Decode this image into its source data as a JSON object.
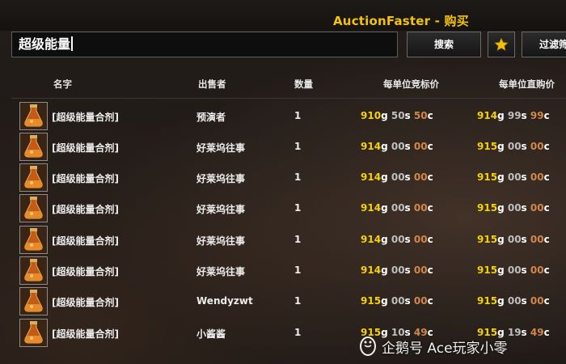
{
  "window": {
    "title": "AuctionFaster - 购买"
  },
  "search": {
    "value": "超级能量"
  },
  "toolbar": {
    "search_label": "搜索",
    "filter_label": "过滤筛"
  },
  "columns": [
    "名字",
    "出售者",
    "数量",
    "每单位竞标价",
    "每单位直购价"
  ],
  "rows": [
    {
      "name": "[超级能量合剂]",
      "seller": "预演者",
      "qty": "1",
      "bid": {
        "g": "910",
        "s": "50",
        "c": "50"
      },
      "buy": {
        "g": "914",
        "s": "99",
        "c": "99"
      }
    },
    {
      "name": "[超级能量合剂]",
      "seller": "好莱坞往事",
      "qty": "1",
      "bid": {
        "g": "914",
        "s": "00",
        "c": "00"
      },
      "buy": {
        "g": "915",
        "s": "00",
        "c": "00"
      }
    },
    {
      "name": "[超级能量合剂]",
      "seller": "好莱坞往事",
      "qty": "1",
      "bid": {
        "g": "914",
        "s": "00",
        "c": "00"
      },
      "buy": {
        "g": "915",
        "s": "00",
        "c": "00"
      }
    },
    {
      "name": "[超级能量合剂]",
      "seller": "好莱坞往事",
      "qty": "1",
      "bid": {
        "g": "914",
        "s": "00",
        "c": "00"
      },
      "buy": {
        "g": "915",
        "s": "00",
        "c": "00"
      }
    },
    {
      "name": "[超级能量合剂]",
      "seller": "好莱坞往事",
      "qty": "1",
      "bid": {
        "g": "914",
        "s": "00",
        "c": "00"
      },
      "buy": {
        "g": "915",
        "s": "00",
        "c": "00"
      }
    },
    {
      "name": "[超级能量合剂]",
      "seller": "好莱坞往事",
      "qty": "1",
      "bid": {
        "g": "914",
        "s": "00",
        "c": "00"
      },
      "buy": {
        "g": "915",
        "s": "00",
        "c": "00"
      }
    },
    {
      "name": "[超级能量合剂]",
      "seller": "Wendyzwt",
      "qty": "1",
      "bid": {
        "g": "915",
        "s": "00",
        "c": "00"
      },
      "buy": {
        "g": "915",
        "s": "00",
        "c": "00"
      }
    },
    {
      "name": "[超级能量合剂]",
      "seller": "小酱酱",
      "qty": "1",
      "bid": {
        "g": "915",
        "s": "10",
        "c": "49"
      },
      "buy": {
        "g": "915",
        "s": "19",
        "c": "49"
      }
    }
  ],
  "units": {
    "gold": "g",
    "silver": "s",
    "copper": "c"
  },
  "watermark": {
    "text": "企鹅号 Ace玩家小零"
  },
  "icons": {
    "item": "potion-flask-icon",
    "star": "star-icon",
    "watermark": "penguin-logo-icon"
  },
  "colors": {
    "title": "#f4c400",
    "gold": "#f6d200",
    "silver": "#bfbfbf",
    "copper": "#d2884a"
  }
}
